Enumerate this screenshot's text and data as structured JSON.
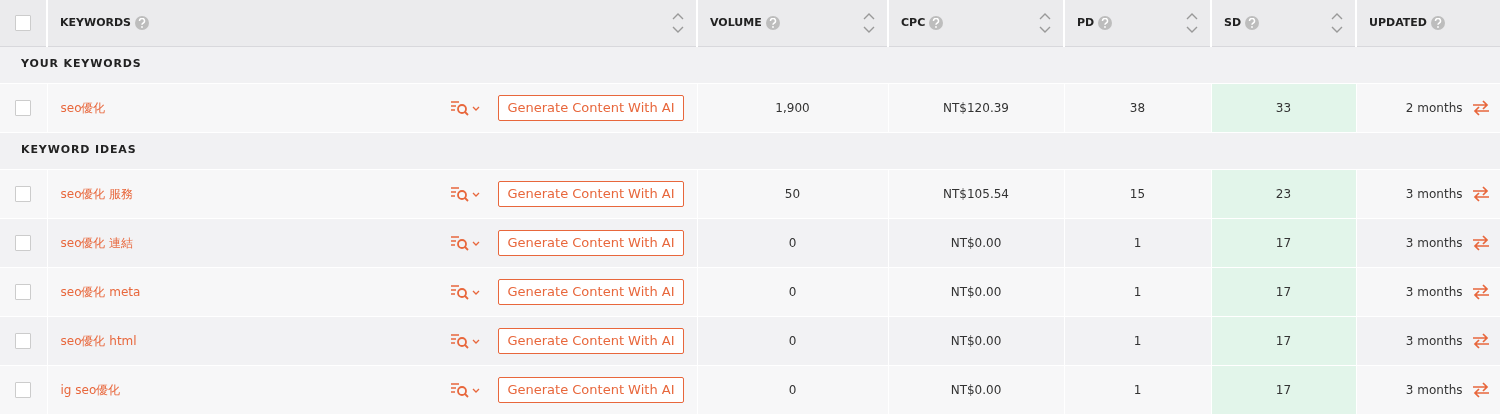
{
  "header": {
    "checked": false,
    "columns": [
      {
        "label": "KEYWORDS",
        "sortable": true
      },
      {
        "label": "VOLUME",
        "sortable": true
      },
      {
        "label": "CPC",
        "sortable": true
      },
      {
        "label": "PD",
        "sortable": true
      },
      {
        "label": "SD",
        "sortable": true
      },
      {
        "label": "UPDATED",
        "sortable": false
      }
    ]
  },
  "sections": [
    {
      "title": "YOUR KEYWORDS",
      "rows": [
        {
          "checked": false,
          "keyword": "seo優化",
          "action": "Generate Content With AI",
          "volume": "1,900",
          "cpc": "NT$120.39",
          "pd": "38",
          "sd": "33",
          "updated": "2 months"
        }
      ]
    },
    {
      "title": "KEYWORD IDEAS",
      "rows": [
        {
          "checked": false,
          "keyword": "seo優化 服務",
          "action": "Generate Content With AI",
          "volume": "50",
          "cpc": "NT$105.54",
          "pd": "15",
          "sd": "23",
          "updated": "3 months"
        },
        {
          "checked": false,
          "keyword": "seo優化 連結",
          "action": "Generate Content With AI",
          "volume": "0",
          "cpc": "NT$0.00",
          "pd": "1",
          "sd": "17",
          "updated": "3 months"
        },
        {
          "checked": false,
          "keyword": "seo優化 meta",
          "action": "Generate Content With AI",
          "volume": "0",
          "cpc": "NT$0.00",
          "pd": "1",
          "sd": "17",
          "updated": "3 months"
        },
        {
          "checked": false,
          "keyword": "seo優化 html",
          "action": "Generate Content With AI",
          "volume": "0",
          "cpc": "NT$0.00",
          "pd": "1",
          "sd": "17",
          "updated": "3 months"
        },
        {
          "checked": false,
          "keyword": "ig seo優化",
          "action": "Generate Content With AI",
          "volume": "0",
          "cpc": "NT$0.00",
          "pd": "1",
          "sd": "17",
          "updated": "3 months"
        }
      ]
    }
  ]
}
